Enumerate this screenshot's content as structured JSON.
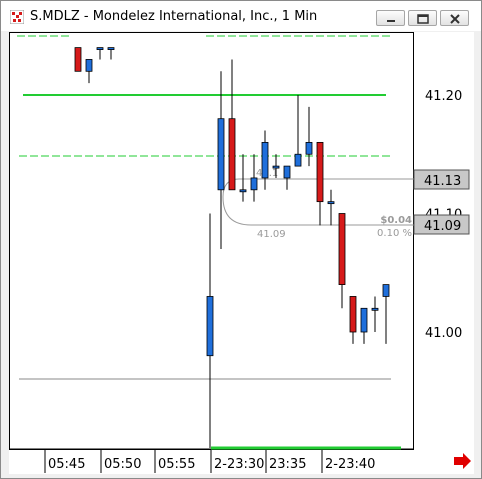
{
  "window": {
    "title": "S.MDLZ - Mondelez International, Inc., 1 Min",
    "minimize_icon": "minimize-icon",
    "maximize_icon": "maximize-icon",
    "close_icon": "close-icon"
  },
  "price_axis": {
    "labels": [
      {
        "text": "41.20",
        "value": 41.2
      },
      {
        "text": "41.10",
        "value": 41.1
      },
      {
        "text": "41.00",
        "value": 41.0
      }
    ],
    "last_price_tag": "41.13",
    "other_price_tag": "41.09"
  },
  "time_axis": {
    "labels": [
      "05:45",
      "05:50",
      "05:55",
      "2-23:30",
      "23:35",
      "2-23:40"
    ]
  },
  "annotations": {
    "measure_price": "41.09",
    "measure_change": "$0.04",
    "measure_percent": "0.10 %",
    "upper_label": "41.1"
  },
  "scroll_arrow_icon": "right-arrow-icon",
  "colors": {
    "up_candle": "#1f6fdb",
    "down_candle": "#d61a1a",
    "green_line": "#22cc33",
    "red_arrow": "#e00000"
  },
  "chart_data": {
    "type": "candlestick",
    "ylim": [
      40.94,
      41.24
    ],
    "green_levels": [
      41.2,
      41.14,
      41.24
    ],
    "gray_levels": [
      40.98
    ],
    "candles": [
      {
        "time": "05:47",
        "open": 41.24,
        "high": 41.24,
        "low": 41.22,
        "close": 41.22
      },
      {
        "time": "05:48",
        "open": 41.22,
        "high": 41.23,
        "low": 41.21,
        "close": 41.23
      },
      {
        "time": "05:49",
        "open": 41.24,
        "high": 41.24,
        "low": 41.23,
        "close": 41.24
      },
      {
        "time": "05:51",
        "open": 41.24,
        "high": 41.24,
        "low": 41.23,
        "close": 41.24
      },
      {
        "time": "2-23:29",
        "open": 40.98,
        "high": 41.1,
        "low": 40.9,
        "close": 41.03
      },
      {
        "time": "2-23:31",
        "open": 41.12,
        "high": 41.22,
        "low": 41.07,
        "close": 41.18
      },
      {
        "time": "2-23:32",
        "open": 41.18,
        "high": 41.23,
        "low": 41.12,
        "close": 41.12
      },
      {
        "time": "2-23:33",
        "open": 41.12,
        "high": 41.15,
        "low": 41.11,
        "close": 41.12
      },
      {
        "time": "2-23:34",
        "open": 41.12,
        "high": 41.15,
        "low": 41.11,
        "close": 41.13
      },
      {
        "time": "2-23:35",
        "open": 41.13,
        "high": 41.17,
        "low": 41.12,
        "close": 41.16
      },
      {
        "time": "2-23:36",
        "open": 41.14,
        "high": 41.15,
        "low": 41.13,
        "close": 41.14
      },
      {
        "time": "2-23:37",
        "open": 41.13,
        "high": 41.14,
        "low": 41.12,
        "close": 41.14
      },
      {
        "time": "2-23:38",
        "open": 41.14,
        "high": 41.2,
        "low": 41.14,
        "close": 41.15
      },
      {
        "time": "2-23:39",
        "open": 41.15,
        "high": 41.19,
        "low": 41.14,
        "close": 41.16
      },
      {
        "time": "2-23:40",
        "open": 41.16,
        "high": 41.16,
        "low": 41.09,
        "close": 41.11
      },
      {
        "time": "2-23:41",
        "open": 41.11,
        "high": 41.12,
        "low": 41.09,
        "close": 41.11
      },
      {
        "time": "2-23:42",
        "open": 41.1,
        "high": 41.1,
        "low": 41.02,
        "close": 41.04
      },
      {
        "time": "2-23:43",
        "open": 41.03,
        "high": 41.03,
        "low": 40.99,
        "close": 41.0
      },
      {
        "time": "2-23:44",
        "open": 41.0,
        "high": 41.02,
        "low": 40.99,
        "close": 41.02
      },
      {
        "time": "2-23:45",
        "open": 41.02,
        "high": 41.03,
        "low": 41.0,
        "close": 41.02
      },
      {
        "time": "2-23:46",
        "open": 41.03,
        "high": 41.04,
        "low": 40.99,
        "close": 41.04
      }
    ]
  }
}
